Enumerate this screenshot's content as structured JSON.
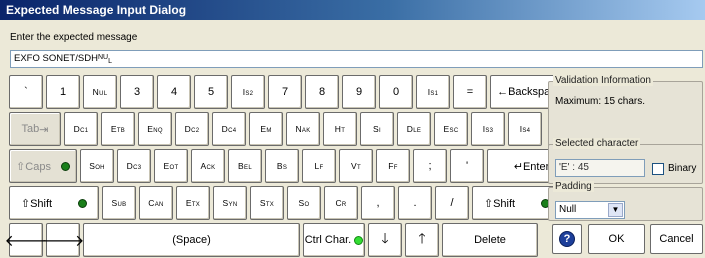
{
  "window": {
    "title": "Expected Message Input Dialog"
  },
  "prompt": "Enter the expected message",
  "message": {
    "main": "EXFO SONET/SDH",
    "sup": "N",
    "sub": "U",
    "sub2": "L"
  },
  "keyboard": {
    "row1": [
      {
        "label": "`"
      },
      {
        "label": "1"
      },
      {
        "main": "N",
        "sub": "U",
        "sub2": "L"
      },
      {
        "label": "3"
      },
      {
        "label": "4"
      },
      {
        "label": "5"
      },
      {
        "main": "I",
        "sub": "S",
        "sub2": "2"
      },
      {
        "label": "7"
      },
      {
        "label": "8"
      },
      {
        "label": "9"
      },
      {
        "label": "0"
      },
      {
        "main": "I",
        "sub": "S",
        "sub2": "1"
      },
      {
        "label": "="
      }
    ],
    "backspace": "←Backspace",
    "tab": "Tab",
    "tab_icon": "⇥",
    "row2": [
      {
        "main": "D",
        "sub": "C",
        "sub2": "1"
      },
      {
        "main": "E",
        "sub": "T",
        "sub2": "B"
      },
      {
        "main": "E",
        "sub": "N",
        "sub2": "Q"
      },
      {
        "main": "D",
        "sub": "C",
        "sub2": "2"
      },
      {
        "main": "D",
        "sub": "C",
        "sub2": "4"
      },
      {
        "main": "E",
        "sub": "M"
      },
      {
        "main": "N",
        "sub": "A",
        "sub2": "K"
      },
      {
        "main": "H",
        "sub": "T"
      },
      {
        "main": "S",
        "sub": "I"
      },
      {
        "main": "D",
        "sub": "L",
        "sub2": "E"
      },
      {
        "main": "E",
        "sub": "S",
        "sub2": "C"
      },
      {
        "main": "I",
        "sub": "S",
        "sub2": "3"
      },
      {
        "main": "I",
        "sub": "S",
        "sub2": "4"
      }
    ],
    "caps": "⇧Caps",
    "row3": [
      {
        "main": "S",
        "sub": "O",
        "sub2": "H"
      },
      {
        "main": "D",
        "sub": "C",
        "sub2": "3"
      },
      {
        "main": "E",
        "sub": "O",
        "sub2": "T"
      },
      {
        "main": "A",
        "sub": "C",
        "sub2": "K"
      },
      {
        "main": "B",
        "sub": "E",
        "sub2": "L"
      },
      {
        "main": "B",
        "sub": "S"
      },
      {
        "main": "L",
        "sub": "F"
      },
      {
        "main": "V",
        "sub": "T"
      },
      {
        "main": "F",
        "sub": "F"
      },
      {
        "label": ";"
      },
      {
        "label": "'"
      }
    ],
    "enter": "↵Enter",
    "shift": "⇧Shift",
    "row4": [
      {
        "main": "S",
        "sub": "U",
        "sub2": "B"
      },
      {
        "main": "C",
        "sub": "A",
        "sub2": "N"
      },
      {
        "main": "E",
        "sub": "T",
        "sub2": "X"
      },
      {
        "main": "S",
        "sub": "Y",
        "sub2": "N"
      },
      {
        "main": "S",
        "sub": "T",
        "sub2": "X"
      },
      {
        "main": "S",
        "sub": "O"
      },
      {
        "main": "C",
        "sub": "R"
      },
      {
        "label": ","
      },
      {
        "label": "."
      },
      {
        "label": "/"
      }
    ],
    "space": "(Space)",
    "ctrl_char": "Ctrl Char.",
    "delete": "Delete"
  },
  "validation": {
    "title": "Validation Information",
    "text": "Maximum:  15 chars."
  },
  "selected": {
    "title": "Selected character",
    "value": "'E' : 45",
    "binary_label": "Binary"
  },
  "padding": {
    "title": "Padding",
    "value": "Null"
  },
  "buttons": {
    "ok": "OK",
    "cancel": "Cancel"
  },
  "colors": {
    "title_start": "#0a246a",
    "title_end": "#a6caf0",
    "led_on": "#33dd33",
    "led_green": "#1a7f1a",
    "help_blue": "#1d3f9a"
  }
}
